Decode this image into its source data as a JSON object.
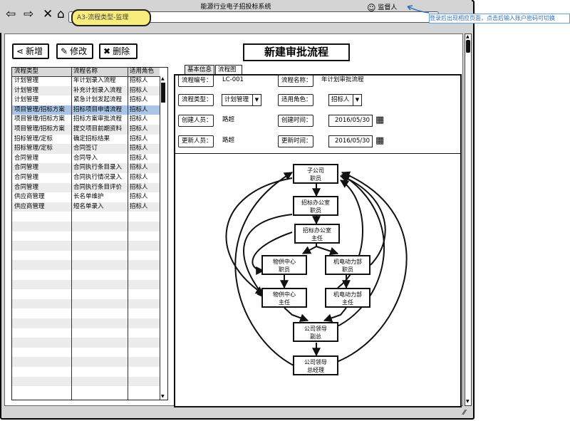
{
  "app": {
    "title": "能源行业电子招投标系统",
    "user": "监督人",
    "address": "A3-流程类型-监理"
  },
  "annotation": {
    "text": "登录后出现相应页面，点击后输入账户密码可切换"
  },
  "toolbar": {
    "add_label": "新增",
    "edit_label": "修改",
    "delete_label": "删除"
  },
  "list": {
    "headers": [
      "流程类型",
      "流程名称",
      "适用角色"
    ],
    "rows": [
      [
        "计划管理",
        "年计划录入流程",
        "招标人"
      ],
      [
        "计划管理",
        "补充计划录入流程",
        "招标人"
      ],
      [
        "计划管理",
        "紧急计划发起流程",
        "招标人"
      ],
      [
        "项目管理/招标方案",
        "招标项目申请流程",
        "招标人"
      ],
      [
        "项目管理/招标方案",
        "招标方案审批流程",
        "招标人"
      ],
      [
        "项目管理/招标方案",
        "提交项目前期资料",
        "招标人"
      ],
      [
        "招标管理/定标",
        "确定招标结果",
        "招标人"
      ],
      [
        "招标管理/定标",
        "合同签订",
        "招标人"
      ],
      [
        "合同管理",
        "合同导入",
        "招标人"
      ],
      [
        "合同管理",
        "合同执行条目录入",
        "招标人"
      ],
      [
        "合同管理",
        "合同执行情况录入",
        "招标人"
      ],
      [
        "合同管理",
        "合同执行条目评价",
        "招标人"
      ],
      [
        "供应商管理",
        "长名单维护",
        "招标人"
      ],
      [
        "供应商管理",
        "短名单录入",
        "招标人"
      ]
    ]
  },
  "detail": {
    "page_title": "新建审批流程",
    "tabs": [
      "基本信息",
      "流程图"
    ],
    "fields": {
      "code_label": "流程编号：",
      "code_value": "LC-001",
      "name_label": "流程名称：",
      "name_value": "年计划审批流程",
      "type_label": "流程类型：",
      "type_value": "计划管理",
      "role_label": "适用角色：",
      "role_value": "招标人",
      "creator_label": "创建人员：",
      "creator_value": "路超",
      "created_label": "创建时间：",
      "created_value": "2016/05/30",
      "updater_label": "更新人员：",
      "updater_value": "路超",
      "updated_label": "更新时间：",
      "updated_value": "2016/05/30"
    }
  },
  "flow": {
    "nodes": [
      [
        "子公司",
        "职员"
      ],
      [
        "招标办公室",
        "职员"
      ],
      [
        "招标办公室",
        "主任"
      ],
      [
        "物供中心",
        "职员"
      ],
      [
        "机电动力部",
        "职员"
      ],
      [
        "物供中心",
        "主任"
      ],
      [
        "机电动力部",
        "主任"
      ],
      [
        "公司领导",
        "副总"
      ],
      [
        "公司领导",
        "总经理"
      ]
    ]
  }
}
